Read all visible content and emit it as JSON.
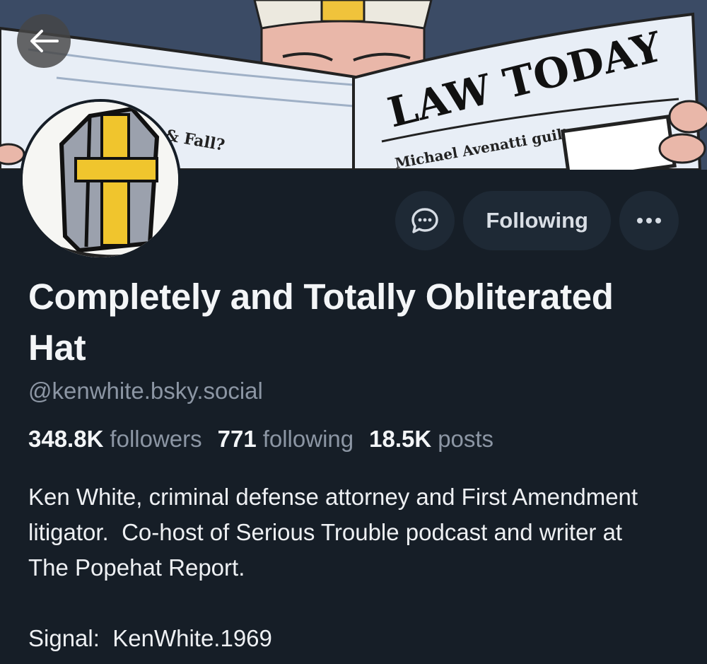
{
  "banner": {
    "newspaper_title": "LAW TODAY",
    "headline_left": "& Fall?",
    "headline_right": "Michael Avenatti guilty"
  },
  "nav": {
    "back_icon": "arrow-left-icon"
  },
  "actions": {
    "message_icon": "message-dots-icon",
    "following_label": "Following",
    "more_icon": "ellipsis-icon"
  },
  "profile": {
    "display_name": "Completely and Totally Obliterated Hat",
    "handle": "@kenwhite.bsky.social",
    "stats": {
      "followers_count": "348.8K",
      "followers_label": "followers",
      "following_count": "771",
      "following_label": "following",
      "posts_count": "18.5K",
      "posts_label": "posts"
    },
    "bio_line1": "Ken White, criminal defense attorney and First Amendment litigator.  Co-host of Serious Trouble podcast and writer at The Popehat Report.",
    "bio_line2": "Signal:  KenWhite.1969"
  },
  "colors": {
    "background": "#161e27",
    "button_bg": "#1e2935",
    "muted_text": "#8c96a4",
    "primary_text": "#f3f5f7"
  }
}
